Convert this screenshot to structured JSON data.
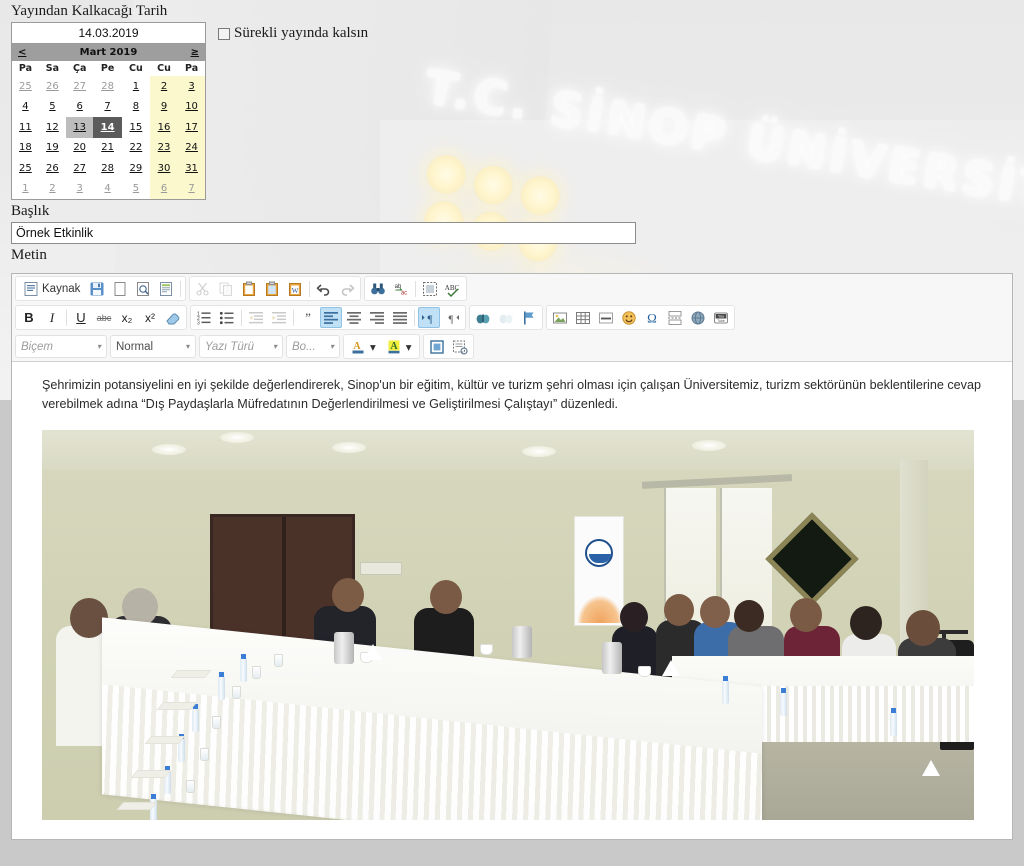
{
  "form": {
    "date_label": "Yayından Kalkacağı Tarih",
    "date_value": "14.03.2019",
    "persist_label": "Sürekli yayında kalsın",
    "persist_checked": false,
    "title_label": "Başlık",
    "title_value": "Örnek Etkinlik",
    "title_placeholder": "",
    "text_label": "Metin"
  },
  "calendar": {
    "prev_label": "<",
    "next_label": "≥",
    "month_title": "Mart 2019",
    "weekdays": [
      "Pa",
      "Sa",
      "Ça",
      "Pe",
      "Cu",
      "Cu",
      "Pa"
    ],
    "selected_day": "14",
    "previous_selection_day": "13",
    "weekend_bg": "#fbf8cd",
    "selected_bg": "#5b5b5b",
    "header_bg": "#9e9e9e",
    "weeks": [
      [
        {
          "d": "25",
          "mute": true,
          "weekend": false
        },
        {
          "d": "26",
          "mute": true,
          "weekend": false
        },
        {
          "d": "27",
          "mute": true,
          "weekend": false
        },
        {
          "d": "28",
          "mute": true,
          "weekend": false
        },
        {
          "d": "1",
          "mute": false,
          "weekend": false
        },
        {
          "d": "2",
          "mute": false,
          "weekend": true
        },
        {
          "d": "3",
          "mute": false,
          "weekend": true
        }
      ],
      [
        {
          "d": "4",
          "mute": false,
          "weekend": false
        },
        {
          "d": "5",
          "mute": false,
          "weekend": false
        },
        {
          "d": "6",
          "mute": false,
          "weekend": false
        },
        {
          "d": "7",
          "mute": false,
          "weekend": false
        },
        {
          "d": "8",
          "mute": false,
          "weekend": false
        },
        {
          "d": "9",
          "mute": false,
          "weekend": true
        },
        {
          "d": "10",
          "mute": false,
          "weekend": true
        }
      ],
      [
        {
          "d": "11",
          "mute": false,
          "weekend": false
        },
        {
          "d": "12",
          "mute": false,
          "weekend": false
        },
        {
          "d": "13",
          "mute": false,
          "weekend": false,
          "prev": true
        },
        {
          "d": "14",
          "mute": false,
          "weekend": false,
          "selected": true
        },
        {
          "d": "15",
          "mute": false,
          "weekend": false
        },
        {
          "d": "16",
          "mute": false,
          "weekend": true
        },
        {
          "d": "17",
          "mute": false,
          "weekend": true
        }
      ],
      [
        {
          "d": "18",
          "mute": false,
          "weekend": false
        },
        {
          "d": "19",
          "mute": false,
          "weekend": false
        },
        {
          "d": "20",
          "mute": false,
          "weekend": false
        },
        {
          "d": "21",
          "mute": false,
          "weekend": false
        },
        {
          "d": "22",
          "mute": false,
          "weekend": false
        },
        {
          "d": "23",
          "mute": false,
          "weekend": true
        },
        {
          "d": "24",
          "mute": false,
          "weekend": true
        }
      ],
      [
        {
          "d": "25",
          "mute": false,
          "weekend": false
        },
        {
          "d": "26",
          "mute": false,
          "weekend": false
        },
        {
          "d": "27",
          "mute": false,
          "weekend": false
        },
        {
          "d": "28",
          "mute": false,
          "weekend": false
        },
        {
          "d": "29",
          "mute": false,
          "weekend": false
        },
        {
          "d": "30",
          "mute": false,
          "weekend": true
        },
        {
          "d": "31",
          "mute": false,
          "weekend": true
        }
      ],
      [
        {
          "d": "1",
          "mute": true,
          "weekend": false
        },
        {
          "d": "2",
          "mute": true,
          "weekend": false
        },
        {
          "d": "3",
          "mute": true,
          "weekend": false
        },
        {
          "d": "4",
          "mute": true,
          "weekend": false
        },
        {
          "d": "5",
          "mute": true,
          "weekend": false
        },
        {
          "d": "6",
          "mute": true,
          "weekend": true
        },
        {
          "d": "7",
          "mute": true,
          "weekend": true
        }
      ]
    ]
  },
  "editor": {
    "toolbar_row1": [
      {
        "name": "source-button",
        "label": "Kaynak",
        "icon": "source-icon",
        "wide": true
      },
      {
        "name": "save-button",
        "icon": "save-icon"
      },
      {
        "name": "new-page-button",
        "icon": "new-page-icon"
      },
      {
        "name": "preview-button",
        "icon": "preview-icon"
      },
      {
        "name": "templates-button",
        "icon": "templates-icon"
      },
      {
        "name": "cut-button",
        "icon": "scissors-icon",
        "dim": true
      },
      {
        "name": "copy-button",
        "icon": "copy-icon",
        "dim": true
      },
      {
        "name": "paste-button",
        "icon": "paste-icon"
      },
      {
        "name": "paste-text-button",
        "icon": "paste-text-icon"
      },
      {
        "name": "paste-word-button",
        "icon": "paste-word-icon"
      },
      {
        "name": "undo-button",
        "icon": "undo-arrow-icon"
      },
      {
        "name": "redo-button",
        "icon": "redo-arrow-icon",
        "dim": true
      },
      {
        "name": "find-button",
        "icon": "binoculars-icon"
      },
      {
        "name": "replace-button",
        "icon": "replace-icon"
      },
      {
        "name": "select-all-button",
        "icon": "select-all-icon"
      },
      {
        "name": "spellcheck-button",
        "icon": "spellcheck-icon"
      }
    ],
    "toolbar_row2": [
      {
        "name": "bold-button",
        "label": "B",
        "icon": "bold-icon"
      },
      {
        "name": "italic-button",
        "label": "I",
        "icon": "italic-icon"
      },
      {
        "name": "underline-button",
        "label": "U",
        "icon": "underline-icon"
      },
      {
        "name": "strikethrough-button",
        "label": "abc",
        "icon": "strikethrough-icon"
      },
      {
        "name": "subscript-button",
        "label": "x₂",
        "icon": "subscript-icon"
      },
      {
        "name": "superscript-button",
        "label": "x²",
        "icon": "superscript-icon"
      },
      {
        "name": "remove-format-button",
        "icon": "eraser-icon"
      },
      {
        "name": "numbered-list-button",
        "icon": "numbered-list-icon"
      },
      {
        "name": "bulleted-list-button",
        "icon": "bulleted-list-icon"
      },
      {
        "name": "outdent-button",
        "icon": "outdent-icon",
        "dim": true
      },
      {
        "name": "indent-button",
        "icon": "indent-icon",
        "dim": true
      },
      {
        "name": "blockquote-button",
        "icon": "quote-icon"
      },
      {
        "name": "align-left-button",
        "icon": "align-left-icon",
        "active": true
      },
      {
        "name": "align-center-button",
        "icon": "align-center-icon"
      },
      {
        "name": "align-right-button",
        "icon": "align-right-icon"
      },
      {
        "name": "justify-button",
        "icon": "align-justify-icon"
      },
      {
        "name": "ltr-button",
        "icon": "text-direction-ltr-icon",
        "active": true
      },
      {
        "name": "rtl-button",
        "icon": "text-direction-rtl-icon"
      },
      {
        "name": "link-button",
        "icon": "link-icon"
      },
      {
        "name": "unlink-button",
        "icon": "unlink-icon",
        "dim": true
      },
      {
        "name": "anchor-button",
        "icon": "flag-icon"
      },
      {
        "name": "image-button",
        "icon": "image-icon"
      },
      {
        "name": "table-button",
        "icon": "table-icon"
      },
      {
        "name": "horizontal-rule-button",
        "icon": "horizontal-rule-icon"
      },
      {
        "name": "smiley-button",
        "icon": "smiley-icon"
      },
      {
        "name": "special-char-button",
        "icon": "omega-icon"
      },
      {
        "name": "page-break-button",
        "icon": "page-break-icon"
      },
      {
        "name": "iframe-button",
        "icon": "globe-icon"
      },
      {
        "name": "youtube-button",
        "icon": "youtube-icon"
      }
    ],
    "selects": [
      {
        "name": "styles-select",
        "value": "Biçem",
        "placeholder": true
      },
      {
        "name": "format-select",
        "value": "Normal",
        "placeholder": false
      },
      {
        "name": "font-select",
        "value": "Yazı Türü",
        "placeholder": true
      },
      {
        "name": "font-size-select",
        "value": "Bo...",
        "placeholder": true
      }
    ],
    "color_buttons": [
      {
        "name": "text-color-button",
        "icon": "text-color-icon",
        "swatch": "#f0b323"
      },
      {
        "name": "background-color-button",
        "icon": "bg-color-icon",
        "swatch": "#f2ef3a"
      }
    ],
    "tool_buttons": [
      {
        "name": "maximize-button",
        "icon": "maximize-icon"
      },
      {
        "name": "show-blocks-button",
        "icon": "show-blocks-icon"
      }
    ],
    "caret": "▾",
    "content": {
      "paragraph": "Şehrimizin potansiyelini en iyi şekilde değerlendirerek, Sinop'un bir eğitim, kültür ve turizm şehri olması için çalışan Üniversitemiz, turizm sektörünün beklentilerine cevap verebilmek adına “Dış Paydaşlarla Müfredatının Değerlendirilmesi ve Geliştirilmesi Çalıştayı” düzenledi.",
      "image_name": "meeting-photo"
    }
  },
  "background": {
    "sign_line": "T.C. SİNOP ÜNİVERSİTESİ"
  }
}
